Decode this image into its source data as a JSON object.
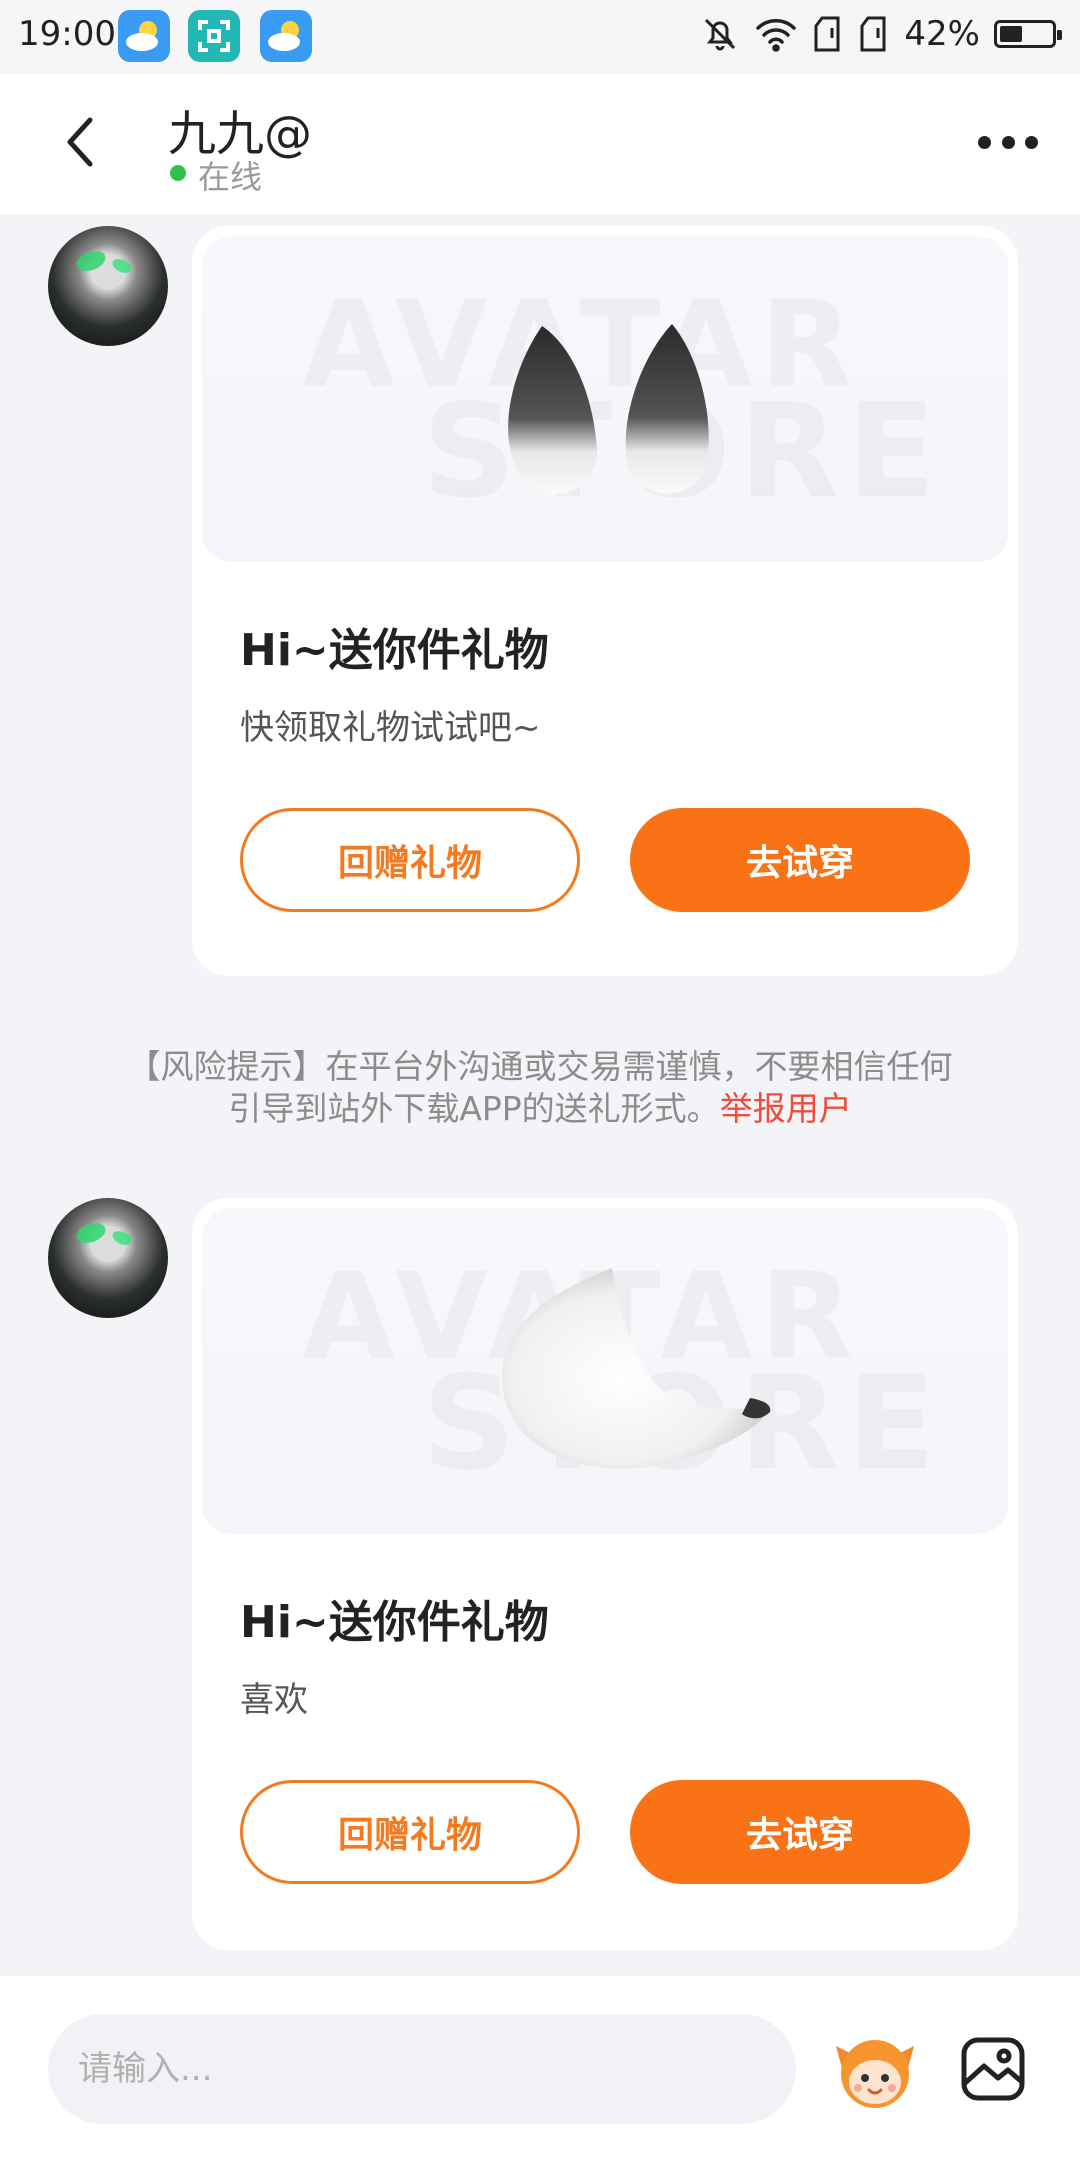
{
  "status_bar": {
    "time": "19:00",
    "battery": "42%",
    "icons": [
      "weather-icon",
      "scan-icon",
      "weather-icon",
      "bell-off-icon",
      "wifi-icon",
      "sim-icon",
      "sim-icon",
      "battery-icon"
    ]
  },
  "header": {
    "name": "九九@",
    "status": "在线",
    "back_icon": "chevron-left-icon",
    "more_icon": "more-dots-icon"
  },
  "messages": [
    {
      "item": "fox-ears",
      "watermark_line1": "AVATAR",
      "watermark_line2": "STORE",
      "title": "Hi~送你件礼物",
      "desc": "快领取礼物试试吧~",
      "return_label": "回赠礼物",
      "try_label": "去试穿"
    },
    {
      "item": "fox-tail",
      "watermark_line1": "AVATAR",
      "watermark_line2": "STORE",
      "title": "Hi~送你件礼物",
      "desc": "喜欢",
      "return_label": "回赠礼物",
      "try_label": "去试穿"
    }
  ],
  "notice": {
    "line1": "【风险提示】在平台外沟通或交易需谨慎，不要相信任何",
    "line2": "引导到站外下载APP的送礼形式。",
    "report_label": "举报用户"
  },
  "input": {
    "placeholder": "请输入..."
  },
  "colors": {
    "accent": "#f97316",
    "online": "#2fc24a",
    "report": "#f04b3b",
    "background": "#f2f4f8"
  }
}
